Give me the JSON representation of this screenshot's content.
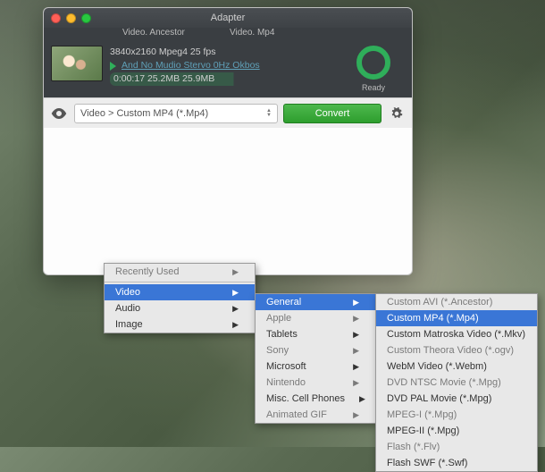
{
  "window": {
    "title": "Adapter",
    "columns": {
      "src": "Video. Ancestor",
      "dst": "Video. Mp4"
    },
    "queue_item": {
      "resolution_line": "3840x2160 Mpeg4 25 fps",
      "link_text": "And No Mudio Stervo 0Hz Okbos",
      "stats_line": "0:00:17 25.2MB 25.9MB",
      "status": "Ready"
    }
  },
  "bottombar": {
    "format_breadcrumb": "Video > Custom MP4 (*.Mp4)",
    "convert_label": "Convert"
  },
  "menu1": {
    "recent": "Recently Used",
    "video": "Video",
    "audio": "Audio",
    "image": "Image"
  },
  "menu2": {
    "general": "General",
    "apple": "Apple",
    "tablets": "Tablets",
    "sony": "Sony",
    "microsoft": "Microsoft",
    "nintendo": "Nintendo",
    "misc": "Misc. Cell Phones",
    "animgif": "Animated GIF"
  },
  "menu3": {
    "avi": "Custom AVI (*.Ancestor)",
    "mp4": "Custom MP4 (*.Mp4)",
    "mkv": "Custom Matroska Video (*.Mkv)",
    "ogv": "Custom Theora Video (*.ogv)",
    "webm": "WebM Video (*.Webm)",
    "ntsc": "DVD NTSC Movie (*.Mpg)",
    "pal": "DVD PAL Movie (*.Mpg)",
    "mpeg1": "MPEG-I (*.Mpg)",
    "mpeg2": "MPEG-II (*.Mpg)",
    "flv": "Flash (*.Flv)",
    "swf": "Flash SWF (*.Swf)"
  }
}
